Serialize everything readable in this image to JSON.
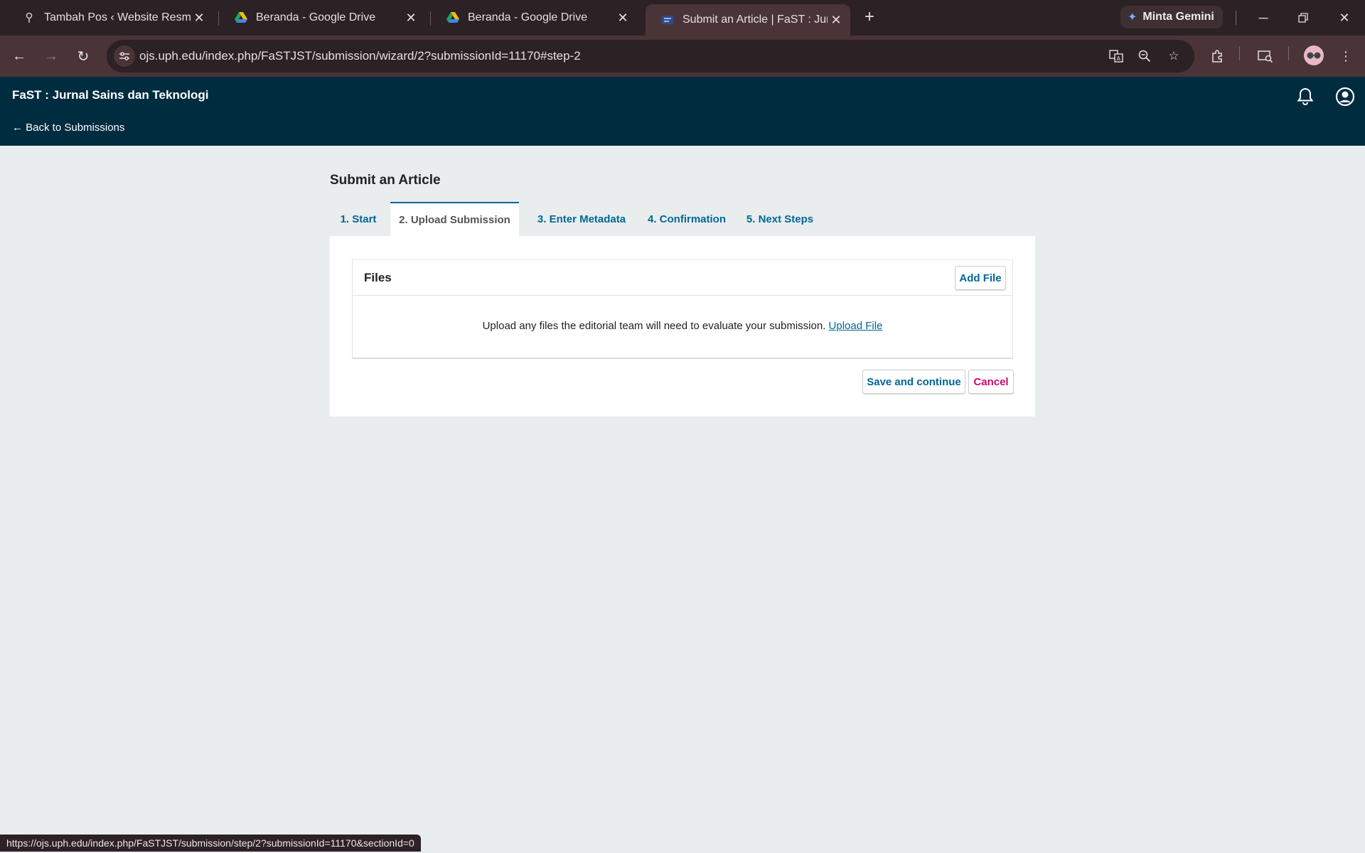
{
  "browser": {
    "tabs": [
      {
        "title": "Tambah Pos ‹ Website Resmi PT",
        "icon": "pin-icon",
        "active": false
      },
      {
        "title": "Beranda - Google Drive",
        "icon": "google-drive-icon",
        "active": false
      },
      {
        "title": "Beranda - Google Drive",
        "icon": "google-drive-icon",
        "active": false
      },
      {
        "title": "Submit an Article | FaST : Jurnal",
        "icon": "ojs-icon",
        "active": true
      }
    ],
    "gemini_label": "Minta Gemini",
    "url": "ojs.uph.edu/index.php/FaSTJST/submission/wizard/2?submissionId=11170#step-2",
    "status_url": "https://ojs.uph.edu/index.php/FaSTJST/submission/step/2?submissionId=11170&sectionId=0"
  },
  "header": {
    "journal_title": "FaST : Jurnal Sains dan Teknologi",
    "back_link": "← Back to Submissions"
  },
  "main": {
    "title": "Submit an Article",
    "steps": [
      {
        "label": "1. Start",
        "active": false
      },
      {
        "label": "2. Upload Submission",
        "active": true
      },
      {
        "label": "3. Enter Metadata",
        "active": false
      },
      {
        "label": "4. Confirmation",
        "active": false
      },
      {
        "label": "5. Next Steps",
        "active": false
      }
    ],
    "files": {
      "title": "Files",
      "add_file_label": "Add File",
      "empty_text": "Upload any files the editorial team will need to evaluate your submission.",
      "upload_link": "Upload File"
    },
    "save_label": "Save and continue",
    "cancel_label": "Cancel"
  },
  "colors": {
    "accent": "#006798",
    "header_bg": "#002c40",
    "cancel": "#d00a6c",
    "page_bg": "#e9edee"
  }
}
